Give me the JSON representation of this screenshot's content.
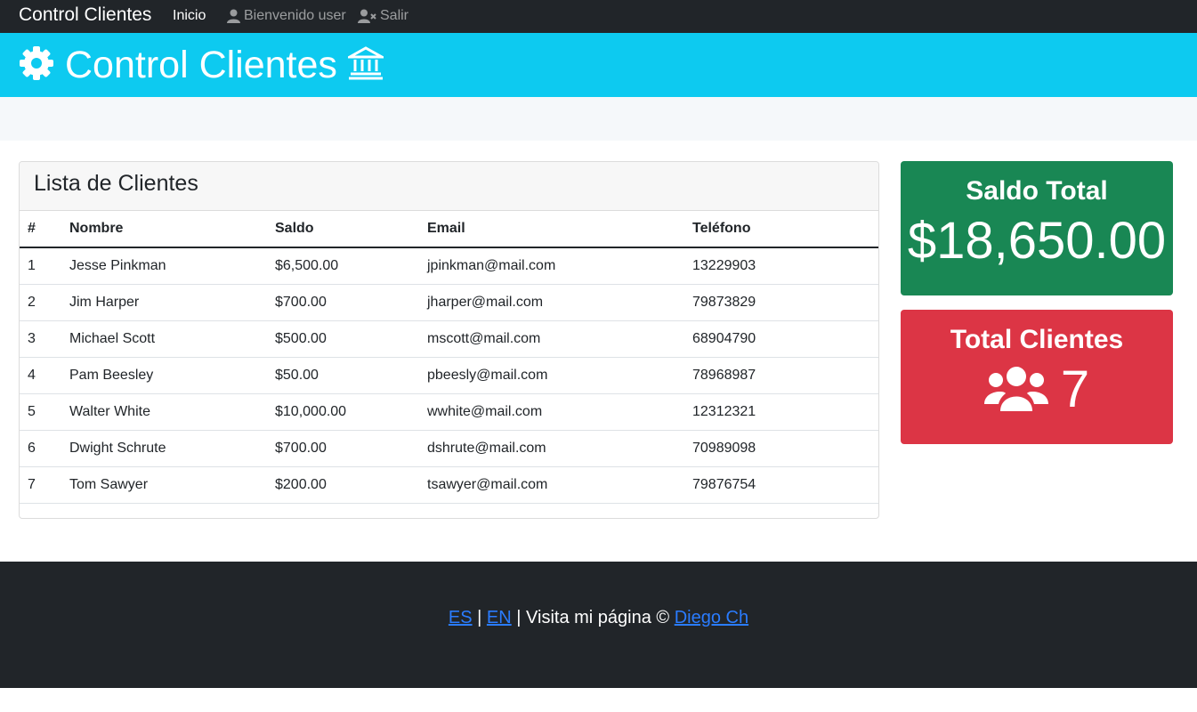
{
  "nav": {
    "brand": "Control Clientes",
    "home": "Inicio",
    "welcome": "Bienvenido user",
    "logout": "Salir"
  },
  "banner": {
    "title": "Control Clientes"
  },
  "list": {
    "title": "Lista de Clientes",
    "headers": [
      "#",
      "Nombre",
      "Saldo",
      "Email",
      "Teléfono"
    ],
    "rows": [
      [
        "1",
        "Jesse Pinkman",
        "$6,500.00",
        "jpinkman@mail.com",
        "13229903"
      ],
      [
        "2",
        "Jim Harper",
        "$700.00",
        "jharper@mail.com",
        "79873829"
      ],
      [
        "3",
        "Michael Scott",
        "$500.00",
        "mscott@mail.com",
        "68904790"
      ],
      [
        "4",
        "Pam Beesley",
        "$50.00",
        "pbeesly@mail.com",
        "78968987"
      ],
      [
        "5",
        "Walter White",
        "$10,000.00",
        "wwhite@mail.com",
        "12312321"
      ],
      [
        "6",
        "Dwight Schrute",
        "$700.00",
        "dshrute@mail.com",
        "70989098"
      ],
      [
        "7",
        "Tom Sawyer",
        "$200.00",
        "tsawyer@mail.com",
        "79876754"
      ]
    ]
  },
  "stats": {
    "saldo_label": "Saldo Total",
    "saldo_value": "$18,650.00",
    "clientes_label": "Total Clientes",
    "clientes_value": "7"
  },
  "footer": {
    "lang_es": "ES",
    "separator": "|",
    "lang_en": "EN",
    "text": "| Visita mi página ©",
    "author": "Diego Ch"
  },
  "icons": {
    "banner_left": "gear-icon",
    "banner_right": "bank-icon",
    "welcome": "user-icon",
    "logout": "user-remove-icon",
    "clientes": "users-icon"
  },
  "colors": {
    "navbar": "#212529",
    "banner": "#0dcaf0",
    "saldo": "#198754",
    "clientes": "#dc3545",
    "link": "#2a7cff"
  }
}
